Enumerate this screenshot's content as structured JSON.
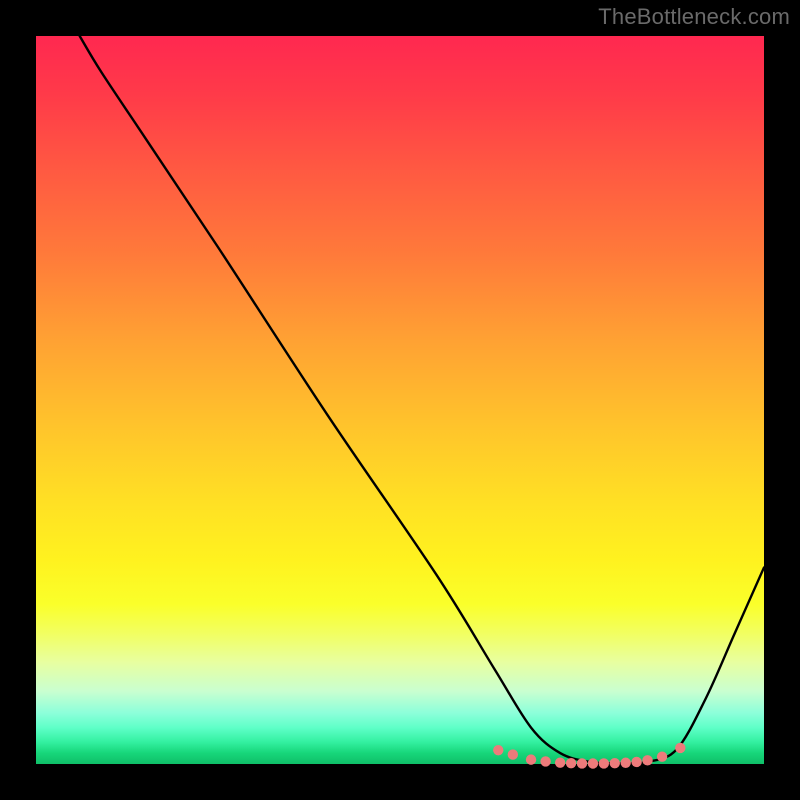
{
  "attribution": "TheBottleneck.com",
  "gradient": {
    "top": "#ff2850",
    "bottom": "#0fbf68"
  },
  "chart_data": {
    "type": "line",
    "title": "",
    "xlabel": "",
    "ylabel": "",
    "xlim": [
      0,
      100
    ],
    "ylim": [
      0,
      100
    ],
    "grid": false,
    "legend": false,
    "series": [
      {
        "name": "bottleneck-curve",
        "color": "#000000",
        "x": [
          6,
          9,
          15,
          25,
          40,
          55,
          63,
          68,
          72,
          76,
          80,
          84,
          88,
          92,
          96,
          100
        ],
        "y": [
          100,
          95,
          86,
          71,
          48,
          26,
          13,
          5,
          1.5,
          0.3,
          0.1,
          0.3,
          2,
          9,
          18,
          27
        ]
      }
    ],
    "markers": [
      {
        "name": "recommended-range-dots",
        "color": "#ed7b7b",
        "x": [
          63.5,
          65.5,
          68,
          70,
          72,
          73.5,
          75,
          76.5,
          78,
          79.5,
          81,
          82.5,
          84,
          86,
          88.5
        ],
        "y": [
          1.9,
          1.3,
          0.6,
          0.35,
          0.18,
          0.11,
          0.08,
          0.07,
          0.08,
          0.11,
          0.17,
          0.28,
          0.5,
          1.0,
          2.2
        ]
      }
    ]
  }
}
